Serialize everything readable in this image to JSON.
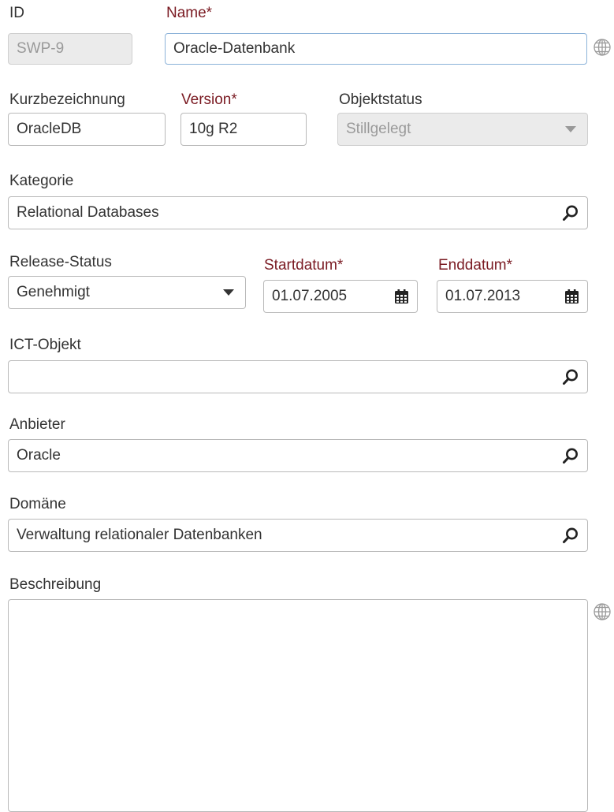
{
  "id": {
    "label": "ID",
    "value": "SWP-9"
  },
  "name": {
    "label": "Name*",
    "value": "Oracle-Datenbank"
  },
  "short_name": {
    "label": "Kurzbezeichnung",
    "value": "OracleDB"
  },
  "version": {
    "label": "Version*",
    "value": "10g R2"
  },
  "object_status": {
    "label": "Objektstatus",
    "value": "Stillgelegt"
  },
  "category": {
    "label": "Kategorie",
    "value": "Relational Databases"
  },
  "release_status": {
    "label": "Release-Status",
    "value": "Genehmigt"
  },
  "start_date": {
    "label": "Startdatum*",
    "value": "01.07.2005"
  },
  "end_date": {
    "label": "Enddatum*",
    "value": "01.07.2013"
  },
  "ict_object": {
    "label": "ICT-Objekt",
    "value": ""
  },
  "vendor": {
    "label": "Anbieter",
    "value": "Oracle"
  },
  "domain": {
    "label": "Domäne",
    "value": "Verwaltung relationaler Datenbanken"
  },
  "description": {
    "label": "Beschreibung",
    "value": ""
  },
  "colors": {
    "required_label": "#7a1a22",
    "text": "#333333",
    "border": "#b9b9b9",
    "readonly_bg": "#ebebeb",
    "focus_border": "#8cb3d9"
  },
  "icons": [
    "globe-icon",
    "search-icon",
    "calendar-icon",
    "chevron-down-icon"
  ]
}
